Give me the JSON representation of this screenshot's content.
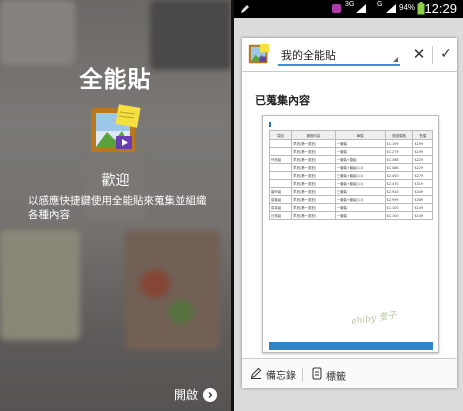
{
  "left_screen": {
    "app_title": "全能貼",
    "welcome_title": "歡迎",
    "description": "以感應快捷鍵使用全能貼來蒐集並組織各種內容",
    "start_button_label": "開啟"
  },
  "status_bar": {
    "signal_3g": "3G",
    "signal_g": "G",
    "battery": "94%",
    "time": "12:29"
  },
  "dialog": {
    "album_name": "我的全能貼",
    "section_title": "已蒐集內容",
    "clip": {
      "watermark": "ehiby 奎子",
      "headers": [
        "項目",
        "服務內容",
        "單價",
        "優惠價格",
        "售價"
      ],
      "rows": [
        [
          "",
          "早拍(第一週拍)",
          "一套裝",
          "$1,199",
          "$199"
        ],
        [
          "",
          "早拍(第一週拍)",
          "一套裝",
          "$1,279",
          "$199"
        ],
        [
          "外拍組",
          "早拍(第一週拍)",
          "一套裝+整組",
          "$1,388",
          "$229"
        ],
        [
          "",
          "早拍(第一週拍)",
          "一套裝+套組(11)",
          "$1,488",
          "$229"
        ],
        [
          "",
          "早拍(第一週拍)",
          "三套裝+套組(11)",
          "$2,450",
          "$279"
        ],
        [
          "",
          "早拍(第一週拍)",
          "一套裝+套組(11)",
          "$2,470",
          "$319"
        ],
        [
          "婚紗組",
          "早拍(第一週拍)",
          "三套裝",
          "$2,920",
          "$349"
        ],
        [
          "宴客組",
          "早拍(第一週拍)",
          "一套裝+套組(11)",
          "$2,999",
          "$389"
        ],
        [
          "寫真組",
          "早拍(第一週拍)",
          "一套裝",
          "$1,100",
          "$149"
        ],
        [
          "日常組",
          "早拍(第一週拍)",
          "一套裝",
          "$1,100",
          "$149"
        ]
      ]
    },
    "footer": {
      "memo_label": "備忘錄",
      "tag_label": "標籤"
    }
  },
  "colors": {
    "accent": "#3b8ed4",
    "clip_blue": "#2d84c8"
  }
}
